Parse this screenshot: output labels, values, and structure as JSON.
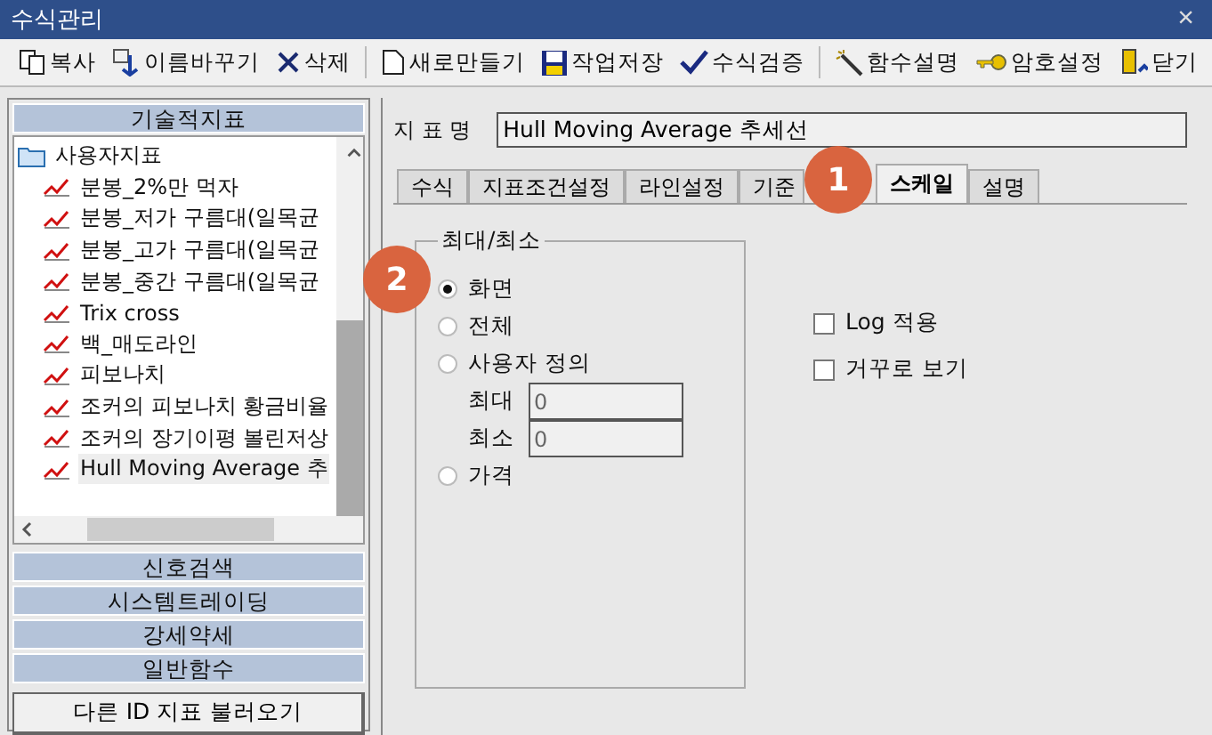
{
  "window": {
    "title": "수식관리",
    "close": "×"
  },
  "toolbar": [
    {
      "label": "복사",
      "kind": "copy"
    },
    {
      "label": "이름바꾸기",
      "kind": "rename"
    },
    {
      "label": "삭제",
      "kind": "delete"
    },
    {
      "label": "새로만들기",
      "kind": "new"
    },
    {
      "label": "작업저장",
      "kind": "save"
    },
    {
      "label": "수식검증",
      "kind": "verify"
    },
    {
      "label": "함수설명",
      "kind": "wand"
    },
    {
      "label": "암호설정",
      "kind": "key"
    },
    {
      "label": "닫기",
      "kind": "exit"
    }
  ],
  "sidebar": {
    "header": "기술적지표",
    "tree": {
      "label": "사용자지표",
      "children": [
        {
          "label": "분봉_2%만 먹자",
          "selected": false
        },
        {
          "label": "분봉_저가 구름대(일목균",
          "selected": false
        },
        {
          "label": "분봉_고가 구름대(일목균",
          "selected": false
        },
        {
          "label": "분봉_중간 구름대(일목균",
          "selected": false
        },
        {
          "label": "Trix cross",
          "selected": false
        },
        {
          "label": "백_매도라인",
          "selected": false
        },
        {
          "label": "피보나치",
          "selected": false
        },
        {
          "label": "조커의 피보나치 황금비율",
          "selected": false
        },
        {
          "label": "조커의 장기이평 볼린저상",
          "selected": false
        },
        {
          "label": "Hull Moving Average 추",
          "selected": true
        }
      ]
    },
    "categories": [
      "신호검색",
      "시스템트레이딩",
      "강세약세",
      "일반함수"
    ],
    "load_button": "다른 ID 지표 불러오기"
  },
  "indicator": {
    "label": "지 표 명",
    "value": "Hull Moving Average 추세선"
  },
  "tabs": [
    {
      "label": "수식",
      "selected": false
    },
    {
      "label": "지표조건설정",
      "selected": false
    },
    {
      "label": "라인설정",
      "selected": false
    },
    {
      "label": "기준",
      "selected": false
    },
    {
      "label": "스케일",
      "selected": true
    },
    {
      "label": "설명",
      "selected": false
    }
  ],
  "scale": {
    "group_title": "최대/최소",
    "options": [
      {
        "label": "화면",
        "selected": true
      },
      {
        "label": "전체",
        "selected": false
      },
      {
        "label": "사용자 정의",
        "selected": false
      },
      {
        "label": "가격",
        "selected": false
      }
    ],
    "max": {
      "label": "최대",
      "value": "0"
    },
    "min": {
      "label": "최소",
      "value": "0"
    },
    "checks": [
      {
        "label": "Log 적용",
        "checked": false
      },
      {
        "label": "거꾸로 보기",
        "checked": false
      }
    ]
  },
  "callouts": [
    "1",
    "2"
  ]
}
